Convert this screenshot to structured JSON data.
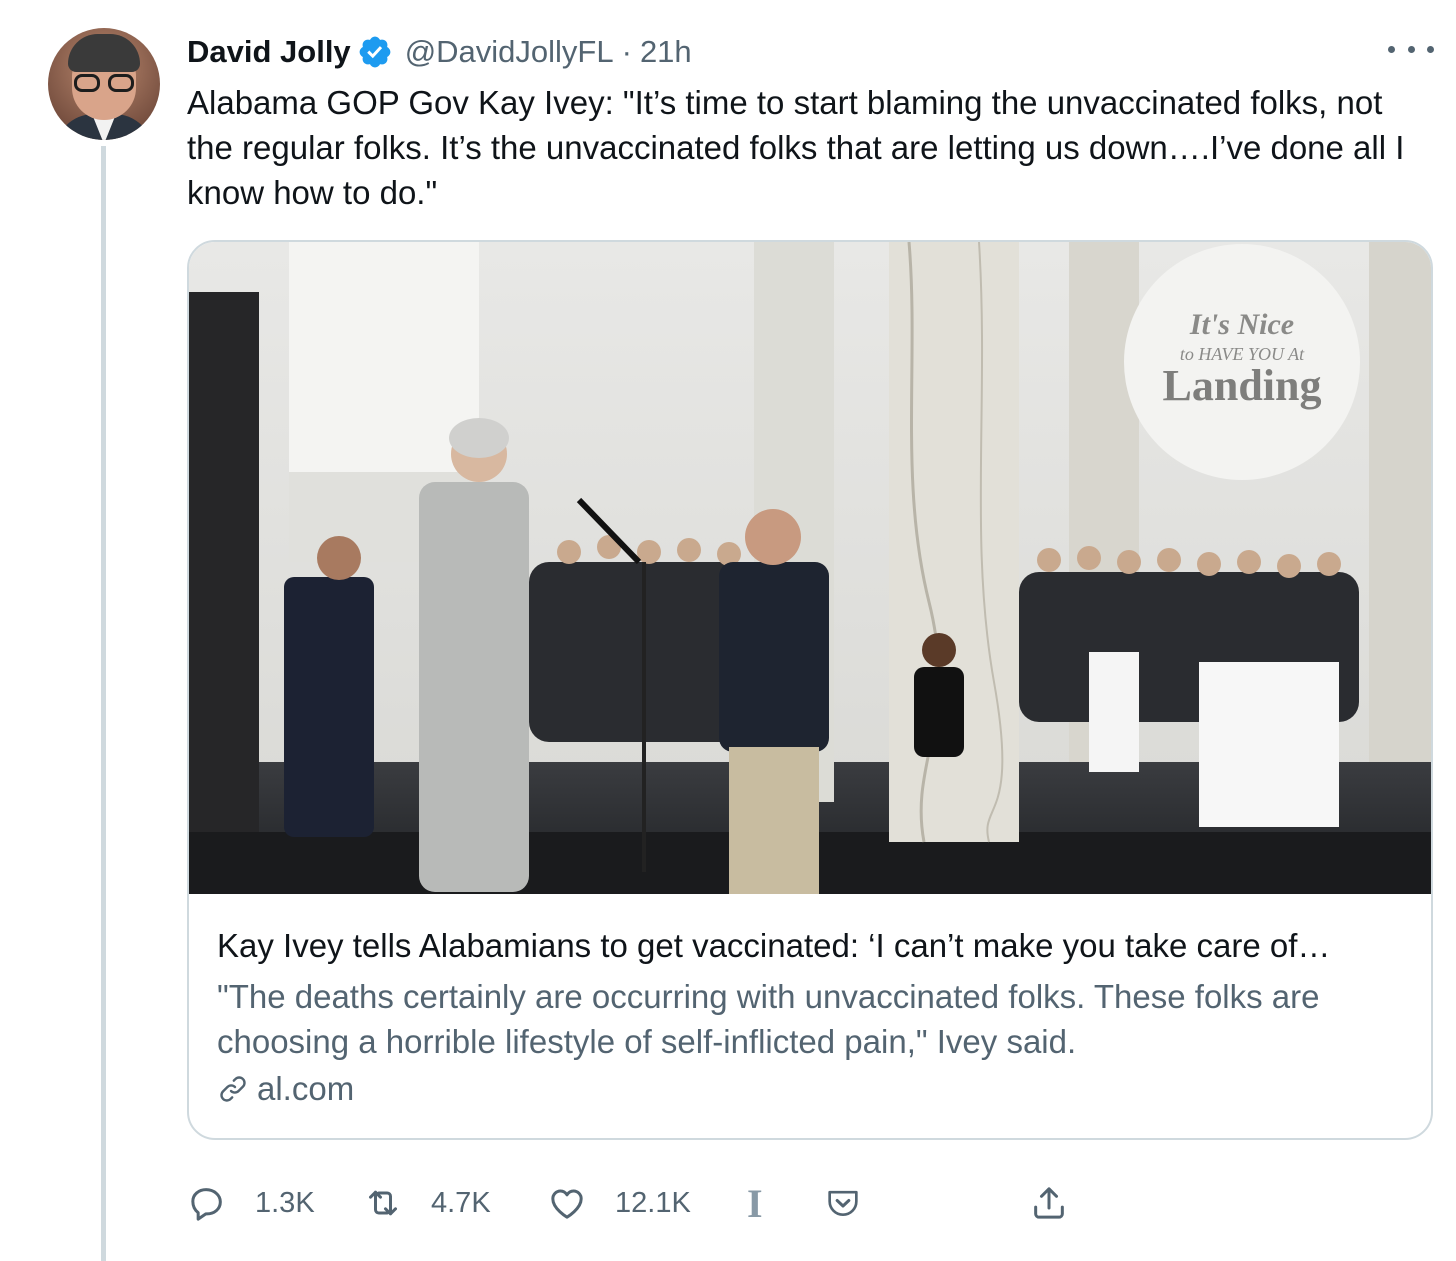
{
  "tweet": {
    "author_name": "David Jolly",
    "handle": "@DavidJollyFL",
    "separator": "·",
    "time": "21h",
    "text": "Alabama GOP Gov Kay Ivey: \"It’s time to start blaming the unvaccinated folks, not the regular folks. It’s the unvaccinated folks that are letting us down….I’ve done all I know how to do.\""
  },
  "card": {
    "image_sign": {
      "line1": "It's Nice",
      "line2": "to HAVE YOU At",
      "line3": "Landing"
    },
    "title": "Kay Ivey tells Alabamians to get vaccinated: ‘I can’t make you take care of…",
    "description": "\"The deaths certainly are occurring with unvaccinated folks. These folks are choosing a horrible lifestyle of self-inflicted pain,\" Ivey said.",
    "domain": "al.com"
  },
  "actions": {
    "reply_count": "1.3K",
    "retweet_count": "4.7K",
    "like_count": "12.1K",
    "ext1_label": "I"
  },
  "colors": {
    "text": "#0f1419",
    "secondary": "#536471",
    "verified": "#1d9bf0",
    "border": "#cfd9de"
  }
}
